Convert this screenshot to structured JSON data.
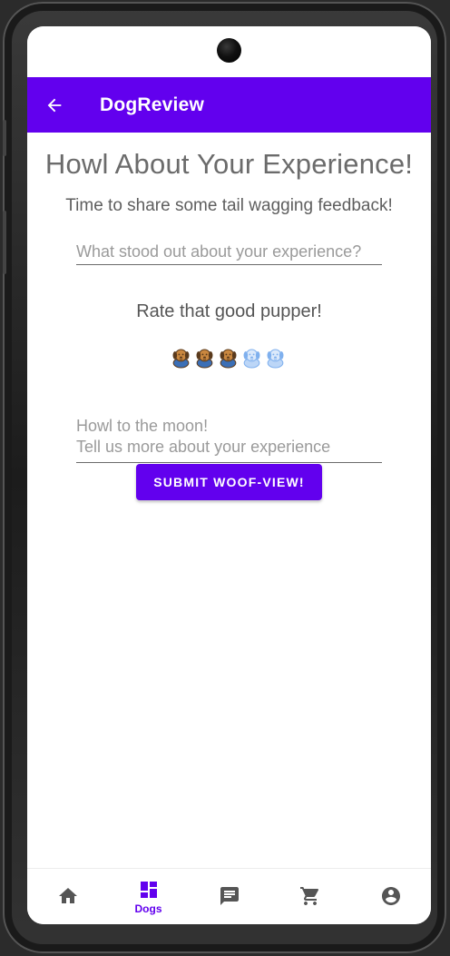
{
  "colors": {
    "primary": "#6200ee",
    "heading_text": "#6b6b6b",
    "nav_inactive": "#555555"
  },
  "appbar": {
    "back_icon": "arrow-back-icon",
    "title": "DogReview"
  },
  "main": {
    "heading": "Howl About Your Experience!",
    "subheading": "Time to share some tail wagging feedback!",
    "highlight_field": {
      "placeholder": "What stood out about your experience?",
      "value": ""
    },
    "rating_label": "Rate that good pupper!",
    "rating": {
      "value": 3,
      "max": 5,
      "icon": "dog-icon"
    },
    "details_field": {
      "placeholder": "Howl to the moon!\nTell us more about your experience",
      "value": ""
    },
    "submit_label": "SUBMIT WOOF-VIEW!"
  },
  "bottom_nav": {
    "items": [
      {
        "icon": "home-icon",
        "label": "",
        "active": false
      },
      {
        "icon": "dashboard-icon",
        "label": "Dogs",
        "active": true
      },
      {
        "icon": "chat-icon",
        "label": "",
        "active": false
      },
      {
        "icon": "cart-icon",
        "label": "",
        "active": false
      },
      {
        "icon": "account-icon",
        "label": "",
        "active": false
      }
    ]
  }
}
